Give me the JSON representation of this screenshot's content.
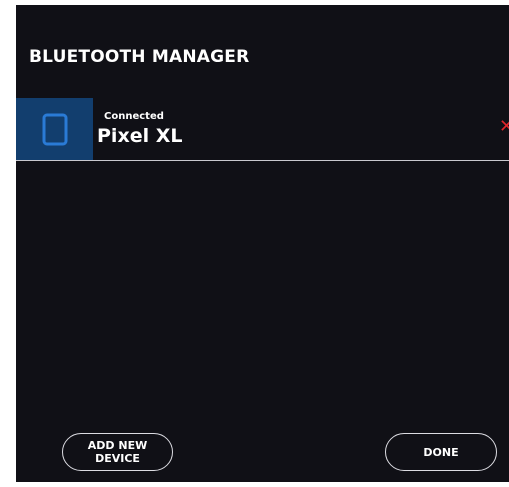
{
  "header": {
    "title": "BLUETOOTH MANAGER"
  },
  "devices": [
    {
      "status": "Connected",
      "name": "Pixel XL",
      "icon": "tablet-icon",
      "remove_icon": "close-icon"
    }
  ],
  "footer": {
    "add_new_line1": "ADD NEW",
    "add_new_line2": "DEVICE",
    "done_label": "DONE"
  },
  "colors": {
    "background": "#101016",
    "icon_box": "#123e6e",
    "icon_stroke": "#2a7bd6",
    "remove_accent": "#e0262b",
    "text": "#ffffff"
  }
}
